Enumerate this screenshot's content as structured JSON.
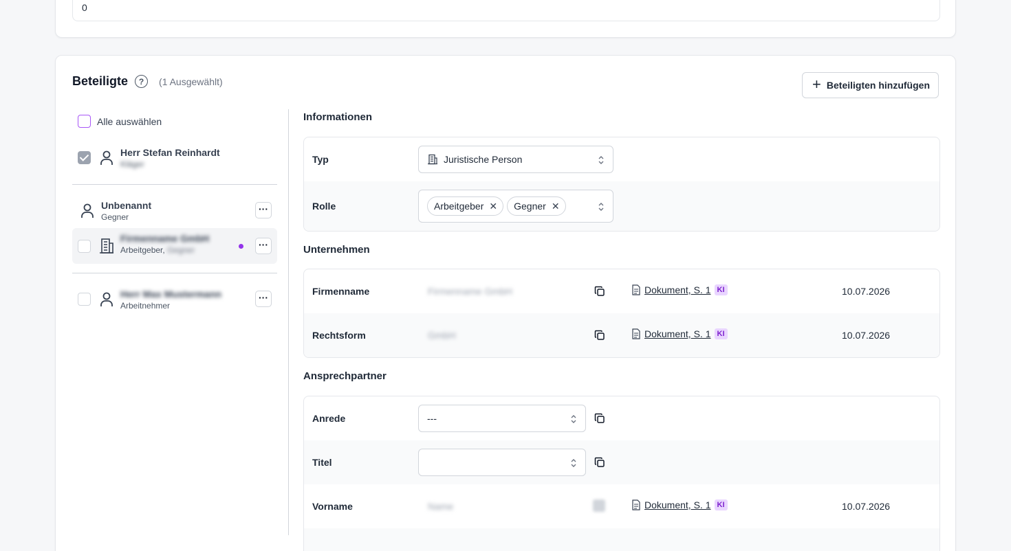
{
  "top_field": {
    "value": "0"
  },
  "section": {
    "title": "Beteiligte",
    "help_icon": "question-circle-icon",
    "selected_count": "(1 Ausgewählt)",
    "add_button_label": "Beteiligten hinzufügen"
  },
  "left": {
    "select_all_label": "Alle auswählen",
    "participants": [
      {
        "name": "Herr Stefan Reinhardt",
        "sub": "Kläger",
        "icon": "person-icon",
        "checked": true
      },
      {
        "name": "Unbenannt",
        "sub": "Gegner",
        "icon": "person-icon"
      },
      {
        "name": "Firmenname GmbH",
        "sub": "Arbeitgeber,",
        "sub_blurred": "Gegner",
        "icon": "building-icon",
        "active": true
      },
      {
        "name": "Herr Max Mustermann",
        "sub": "Arbeitnehmer",
        "icon": "person-icon"
      }
    ],
    "more_label": "···"
  },
  "info": {
    "title": "Informationen",
    "typ_label": "Typ",
    "typ_value": "Juristische Person",
    "rolle_label": "Rolle",
    "roles": [
      "Arbeitgeber",
      "Gegner"
    ]
  },
  "company": {
    "title": "Unternehmen",
    "rows": [
      {
        "label": "Firmenname",
        "value": "Firmenname GmbH",
        "source": "Dokument, S. 1",
        "badge": "KI",
        "date": "10.07.2026"
      },
      {
        "label": "Rechtsform",
        "value": "GmbH",
        "source": "Dokument, S. 1",
        "badge": "KI",
        "date": "10.07.2026"
      }
    ]
  },
  "contact": {
    "title": "Ansprechpartner",
    "anrede_label": "Anrede",
    "anrede_value": "---",
    "titel_label": "Titel",
    "titel_value": "",
    "vorname_label": "Vorname",
    "vorname_value": "Name",
    "vorname_source": "Dokument, S. 1",
    "vorname_badge": "KI",
    "vorname_date": "10.07.2026"
  }
}
